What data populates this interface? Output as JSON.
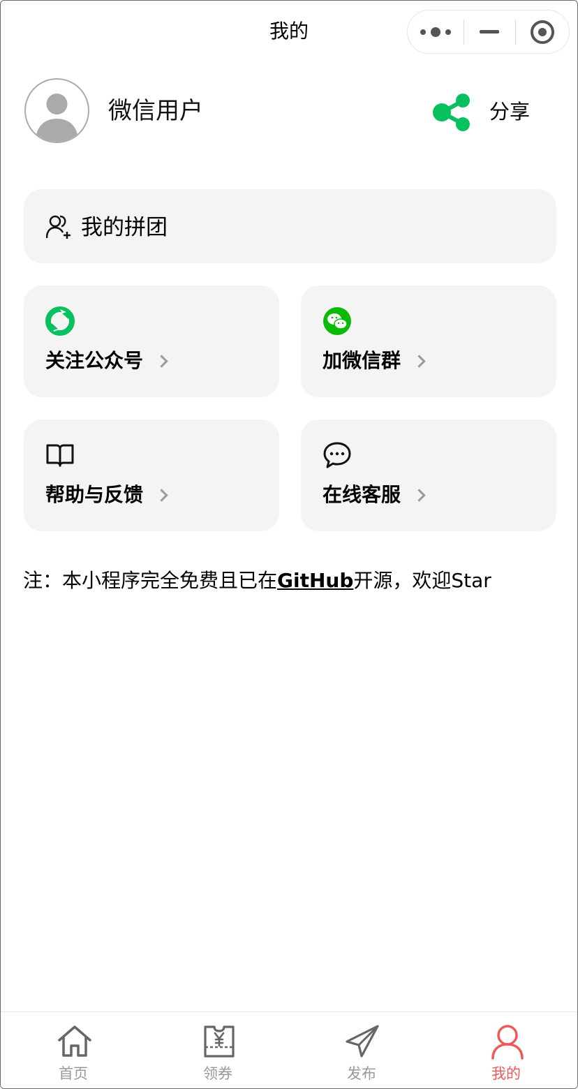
{
  "nav": {
    "title": "我的"
  },
  "profile": {
    "name": "微信用户",
    "share_label": "分享"
  },
  "group_buy": {
    "label": "我的拼团"
  },
  "tiles": [
    {
      "label": "关注公众号",
      "icon": "official-account-icon"
    },
    {
      "label": "加微信群",
      "icon": "wechat-icon"
    },
    {
      "label": "帮助与反馈",
      "icon": "book-icon"
    },
    {
      "label": "在线客服",
      "icon": "chat-bubble-icon"
    }
  ],
  "note": {
    "prefix": "注：本小程序完全免费且已在",
    "link": "GitHub",
    "suffix": "开源，欢迎Star"
  },
  "tabbar": [
    {
      "label": "首页",
      "icon": "home-icon",
      "active": false
    },
    {
      "label": "领券",
      "icon": "coupon-icon",
      "active": false
    },
    {
      "label": "发布",
      "icon": "paper-plane-icon",
      "active": false
    },
    {
      "label": "我的",
      "icon": "user-icon",
      "active": true
    }
  ],
  "colors": {
    "accent_green": "#07c160",
    "wechat_green": "#09bb07",
    "active_tab": "#ee5a5a",
    "inactive_tab": "#999999",
    "card_bg": "#f4f4f4"
  }
}
